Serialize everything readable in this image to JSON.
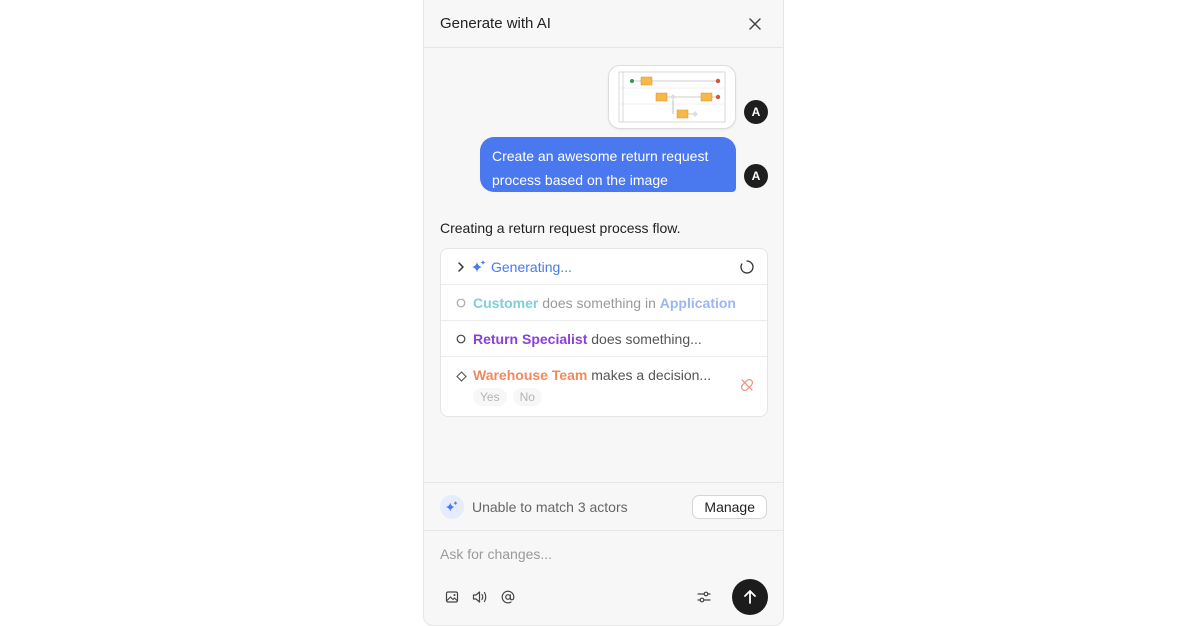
{
  "header": {
    "title": "Generate with AI"
  },
  "conversation": {
    "user_avatar_initial": "A",
    "user_message": "Create an awesome return request process based on the image",
    "assistant_status": "Creating a return request process flow."
  },
  "steps": {
    "generating_label": "Generating...",
    "items": [
      {
        "actor": "Customer",
        "text1": " does something in ",
        "system": "Application"
      },
      {
        "actor": "Return Specialist",
        "text1": " does something..."
      },
      {
        "actor": "Warehouse Team",
        "text1": " makes a decision...",
        "branches": [
          "Yes",
          "No"
        ]
      }
    ]
  },
  "match_bar": {
    "text": "Unable to match 3 actors",
    "button": "Manage"
  },
  "composer": {
    "placeholder": "Ask for changes..."
  },
  "colors": {
    "accent": "#4a78ef",
    "send_button": "#1c1c1c"
  }
}
